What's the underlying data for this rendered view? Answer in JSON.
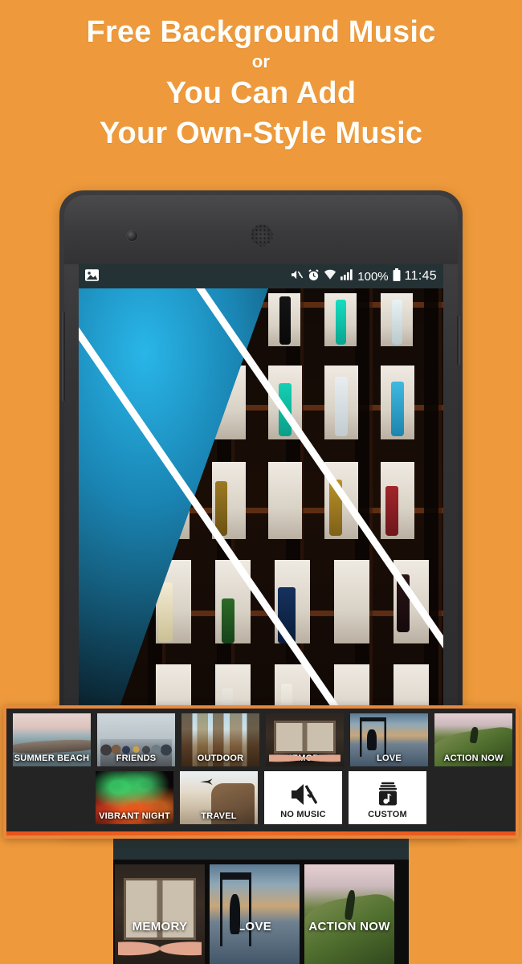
{
  "headline": {
    "line1": "Free Background Music",
    "line_or": "or",
    "line2": "You Can Add",
    "line3": "Your Own-Style Music"
  },
  "colors": {
    "background": "#ee9a3c",
    "panel_border": "#e8883a",
    "panel_background": "#242424",
    "accent_bar": "#e8531c",
    "statusbar": "#243235",
    "selection": "#ffffff"
  },
  "phone": {
    "statusbar": {
      "gallery_icon": "image-icon",
      "mute_icon": "volume-mute-icon",
      "alarm_icon": "alarm-clock-icon",
      "wifi_icon": "wifi-icon",
      "signal_icon": "cellular-signal-icon",
      "battery_percent": "100%",
      "battery_icon": "battery-full-icon",
      "time": "11:45"
    },
    "preview": {
      "transition": "diagonal-split",
      "photo_a": "bottles-on-shelf",
      "photo_b": "woman-hand-hair-blue"
    }
  },
  "music_panel": {
    "selected": "SUMMER BEACH",
    "row1": [
      {
        "label": "SUMMER BEACH",
        "art": "art-beach",
        "selected": true
      },
      {
        "label": "FRIENDS",
        "art": "art-friends",
        "selected": false
      },
      {
        "label": "OUTDOOR",
        "art": "art-outdoor",
        "selected": false
      },
      {
        "label": "MEMORY",
        "art": "art-memory",
        "selected": false
      },
      {
        "label": "LOVE",
        "art": "art-love",
        "selected": false
      },
      {
        "label": "ACTION NOW",
        "art": "art-action",
        "selected": false
      }
    ],
    "row2": [
      {
        "label": "VIBRANT NIGHT",
        "art": "art-vibrant",
        "selected": false
      },
      {
        "label": "TRAVEL",
        "art": "art-travel",
        "selected": false
      },
      {
        "label": "NO MUSIC",
        "art": "white",
        "icon": "volume-mute-icon",
        "selected": false
      },
      {
        "label": "CUSTOM",
        "art": "white",
        "icon": "music-note-box-icon",
        "selected": false
      }
    ]
  },
  "bottom_row": {
    "items": [
      {
        "label": "MEMORY",
        "art": "art-memory"
      },
      {
        "label": "LOVE",
        "art": "art-love"
      },
      {
        "label": "ACTION NOW",
        "art": "art-action"
      }
    ]
  }
}
